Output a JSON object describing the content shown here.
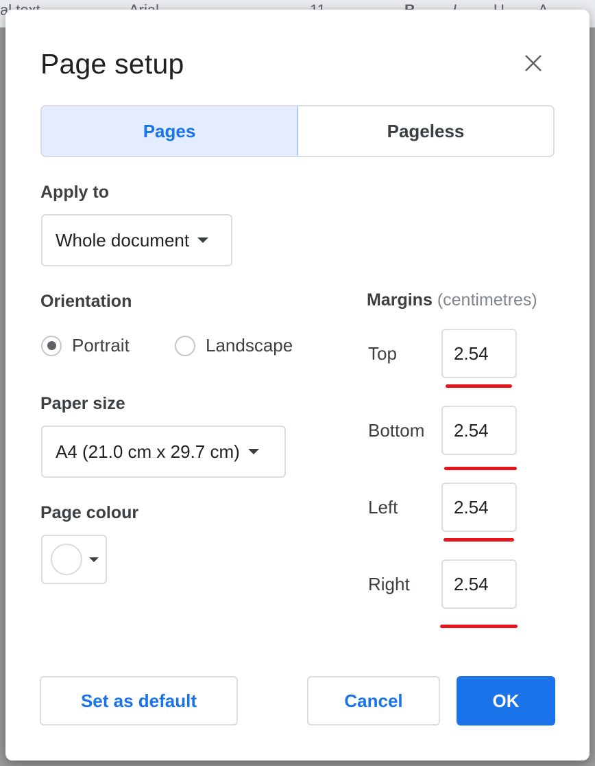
{
  "background": {
    "toolbar_fragments": [
      "al text",
      "Arial",
      "11",
      "B",
      "I",
      "U",
      "A"
    ]
  },
  "dialog": {
    "title": "Page setup",
    "tabs": [
      {
        "label": "Pages",
        "active": true
      },
      {
        "label": "Pageless",
        "active": false
      }
    ],
    "apply_to": {
      "label": "Apply to",
      "value": "Whole document"
    },
    "orientation": {
      "label": "Orientation",
      "options": [
        {
          "label": "Portrait",
          "selected": true
        },
        {
          "label": "Landscape",
          "selected": false
        }
      ]
    },
    "paper_size": {
      "label": "Paper size",
      "value": "A4 (21.0 cm x 29.7 cm)"
    },
    "page_colour": {
      "label": "Page colour",
      "value": "#ffffff"
    },
    "margins": {
      "label": "Margins",
      "unit": "(centimetres)",
      "fields": [
        {
          "label": "Top",
          "value": "2.54"
        },
        {
          "label": "Bottom",
          "value": "2.54"
        },
        {
          "label": "Left",
          "value": "2.54"
        },
        {
          "label": "Right",
          "value": "2.54"
        }
      ]
    },
    "buttons": {
      "set_default": "Set as default",
      "cancel": "Cancel",
      "ok": "OK"
    }
  },
  "colors": {
    "accent": "#1a73e8",
    "annotation": "#e8141c"
  }
}
